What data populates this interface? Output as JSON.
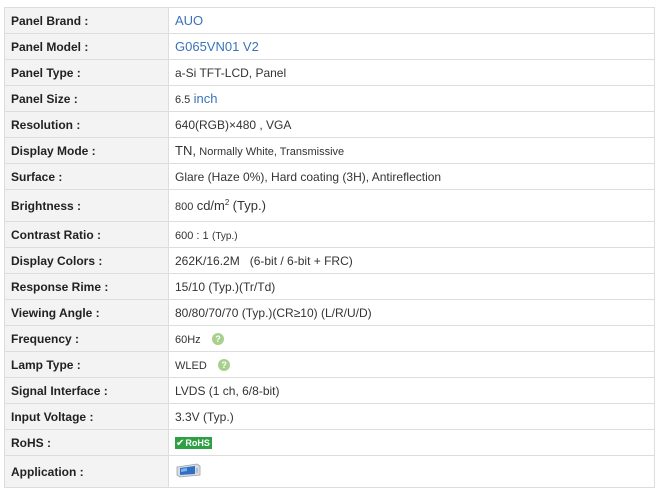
{
  "rows": [
    {
      "label": "Panel Brand :",
      "value": "AUO"
    },
    {
      "label": "Panel Model :",
      "value": "G065VN01 V2"
    },
    {
      "label": "Panel Type :",
      "value": "a-Si TFT-LCD, Panel"
    },
    {
      "label": "Panel Size :",
      "value_num": "6.5",
      "value_unit": "inch"
    },
    {
      "label": "Resolution :",
      "value": "640(RGB)×480 , VGA"
    },
    {
      "label": "Display Mode :",
      "value_a": "TN,",
      "value_b": "Normally White, Transmissive"
    },
    {
      "label": "Surface :",
      "value": "Glare (Haze 0%), Hard coating (3H), Antireflection"
    },
    {
      "label": "Brightness :",
      "value_num": "800",
      "value_unit": "cd/m",
      "value_sup": "2",
      "value_tail": "(Typ.)"
    },
    {
      "label": "Contrast Ratio :",
      "value_num": "600 : 1",
      "value_tail": "(Typ.)"
    },
    {
      "label": "Display Colors :",
      "value": "262K/16.2M   (6-bit / 6-bit + FRC)"
    },
    {
      "label": "Response Rime :",
      "value": "15/10 (Typ.)(Tr/Td)"
    },
    {
      "label": "Viewing Angle :",
      "value": "80/80/70/70 (Typ.)(CR≥10) (L/R/U/D)"
    },
    {
      "label": "Frequency :",
      "value": "60Hz",
      "help_icon": "question-icon"
    },
    {
      "label": "Lamp Type :",
      "value": "WLED",
      "help_icon": "question-icon"
    },
    {
      "label": "Signal Interface :",
      "value": "LVDS (1 ch, 6/8-bit)"
    },
    {
      "label": "Input Voltage :",
      "value": "3.3V (Typ.)"
    },
    {
      "label": "RoHS :",
      "badge_text": "RoHS",
      "badge_icon": "check-icon",
      "badge_color": "#2ea043"
    },
    {
      "label": "Application :",
      "icon": "industrial-display-icon"
    }
  ],
  "colors": {
    "label_bg": "#f3f3f3",
    "border": "#dddddd",
    "link": "#3b73b9",
    "help": "#a8d08d"
  }
}
